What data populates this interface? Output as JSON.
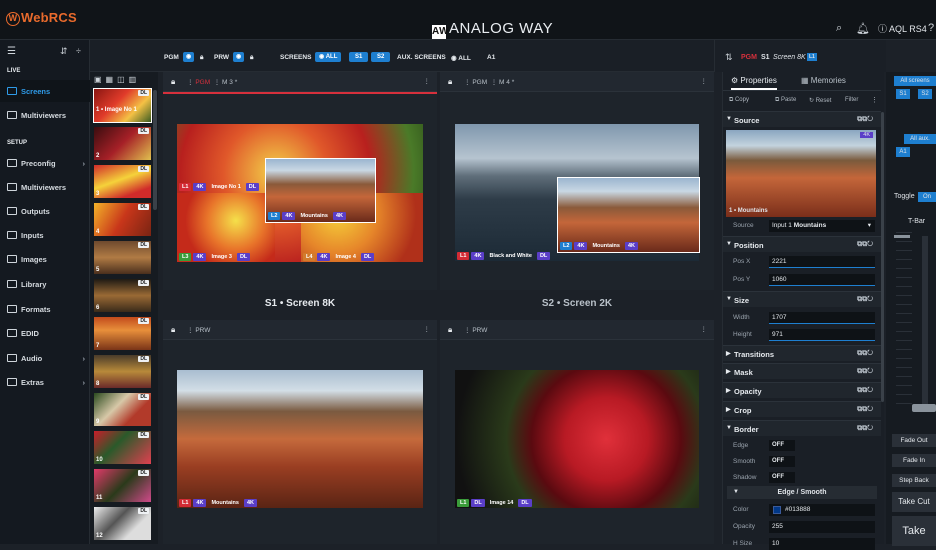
{
  "app": {
    "logo": "WebRCS",
    "brand": "ANALOG WAY",
    "device": "AQL RS4"
  },
  "sidebar": {
    "live_label": "LIVE",
    "setup_label": "SETUP",
    "live_items": [
      {
        "label": "Screens"
      },
      {
        "label": "Multiviewers"
      }
    ],
    "setup_items": [
      {
        "label": "Preconfig"
      },
      {
        "label": "Multiviewers"
      },
      {
        "label": "Outputs"
      },
      {
        "label": "Inputs"
      },
      {
        "label": "Images"
      },
      {
        "label": "Library"
      },
      {
        "label": "Formats"
      },
      {
        "label": "EDID"
      },
      {
        "label": "Audio"
      },
      {
        "label": "Extras"
      }
    ]
  },
  "controlbar": {
    "pgm": "PGM",
    "prw": "PRW",
    "screens": "SCREENS",
    "all": "ALL",
    "s1": "S1",
    "s2": "S2",
    "aux": "AUX. SCREENS",
    "aux_all": "ALL",
    "aux_a1": "A1"
  },
  "thumbs": [
    {
      "num": "1",
      "name": "Image No 1",
      "dl": "DL"
    },
    {
      "num": "2",
      "dl": "DL"
    },
    {
      "num": "3",
      "dl": "DL"
    },
    {
      "num": "4",
      "dl": "DL"
    },
    {
      "num": "5",
      "dl": "DL"
    },
    {
      "num": "6",
      "dl": "DL"
    },
    {
      "num": "7",
      "dl": "DL"
    },
    {
      "num": "8",
      "dl": "DL"
    },
    {
      "num": "9",
      "dl": "DL"
    },
    {
      "num": "10",
      "dl": "DL"
    },
    {
      "num": "11",
      "dl": "DL"
    },
    {
      "num": "12",
      "dl": "DL"
    }
  ],
  "screens": {
    "s1": {
      "title": "S1 • Screen 8K",
      "pgm": "PGM",
      "mem": "M 3 *",
      "prw": "PRW"
    },
    "s2": {
      "title": "S2 • Screen 2K",
      "pgm": "PGM",
      "mem": "M 4 *",
      "prw": "PRW"
    }
  },
  "layers": {
    "s1_pgm": [
      {
        "id": "L1",
        "res": "4K",
        "name": "Image No 1",
        "tag": "DL"
      },
      {
        "id": "L2",
        "res": "4K",
        "name": "Mountains",
        "tag": "4K"
      },
      {
        "id": "L3",
        "res": "4K",
        "name": "Image 3",
        "tag": "DL"
      },
      {
        "id": "L4",
        "res": "4K",
        "name": "Image 4",
        "tag": "DL"
      }
    ],
    "s2_pgm": [
      {
        "id": "L1",
        "res": "4K",
        "name": "Black and White",
        "tag": "DL"
      },
      {
        "id": "L2",
        "res": "4K",
        "name": "Mountains",
        "tag": "4K"
      }
    ],
    "s1_prw": [
      {
        "id": "L1",
        "res": "4K",
        "name": "Mountains",
        "tag": "4K"
      }
    ],
    "s2_prw": [
      {
        "id": "L1",
        "res": "DL",
        "name": "Image 14",
        "tag": "DL"
      }
    ]
  },
  "props": {
    "header": {
      "pgm": "PGM",
      "screen": "S1",
      "screen_name": "Screen 8K",
      "layer": "L1"
    },
    "tabs": [
      "Properties",
      "Memories"
    ],
    "toolbar": {
      "copy": "Copy",
      "paste": "Paste",
      "reset": "Reset",
      "filter": "Filter"
    },
    "source": {
      "title": "Source",
      "preview_label": "1 • Mountains",
      "preview_badge": "4K",
      "label": "Source",
      "input_prefix": "Input 1",
      "input_name": "Mountains"
    },
    "position": {
      "title": "Position",
      "x_label": "Pos X",
      "x": "2221",
      "y_label": "Pos Y",
      "y": "1060"
    },
    "size": {
      "title": "Size",
      "w_label": "Width",
      "w": "1707",
      "h_label": "Height",
      "h": "971"
    },
    "collapsed": [
      "Transitions",
      "Mask",
      "Opacity",
      "Crop"
    ],
    "border": {
      "title": "Border",
      "edge_label": "Edge",
      "edge": "OFF",
      "smooth_label": "Smooth",
      "smooth": "OFF",
      "shadow_label": "Shadow",
      "shadow": "OFF",
      "sub_title": "Edge / Smooth",
      "color_label": "Color",
      "color": "#013888",
      "opacity_label": "Opacity",
      "opacity": "255",
      "hsize_label": "H Size",
      "hsize": "10"
    }
  },
  "rightcol": {
    "all_screens": "All screens",
    "s1": "S1",
    "s2": "S2",
    "all_aux": "All aux.",
    "a1": "A1",
    "toggle": "Toggle",
    "toggle_state": "On",
    "tbar": "T-Bar",
    "fade_out": "Fade Out",
    "fade_in": "Fade In",
    "step_back": "Step Back",
    "take_cut": "Take Cut",
    "take": "Take"
  },
  "colors": {
    "accent": "#1e7fd0",
    "pgm_red": "#d6303c",
    "logo": "#e86a2c"
  }
}
